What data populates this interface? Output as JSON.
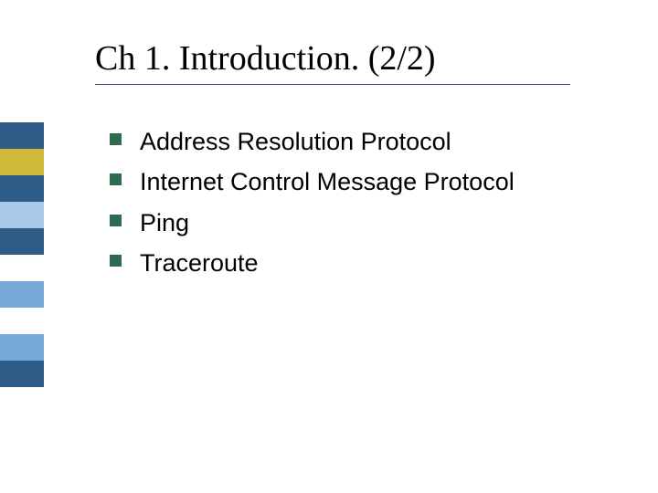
{
  "title": "Ch 1. Introduction. (2/2)",
  "bullets": {
    "items": [
      {
        "text": "Address Resolution Protocol"
      },
      {
        "text": "Internet Control Message Protocol"
      },
      {
        "text": "Ping"
      },
      {
        "text": "Traceroute"
      }
    ]
  },
  "deco_colors": [
    "#2e5c88",
    "#d0b838",
    "#2e5c88",
    "#a8c8e8",
    "#2e5c88",
    "#ffffff",
    "#78a8d8",
    "#ffffff",
    "#78a8d8",
    "#2e5c88"
  ]
}
